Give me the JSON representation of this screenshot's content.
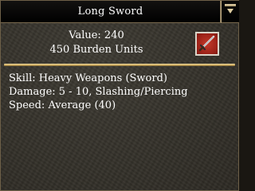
{
  "window": {
    "title": "Long Sword"
  },
  "item": {
    "value_text": "Value: 240",
    "burden_text": "450 Burden Units",
    "icon": "sword-icon"
  },
  "stats": [
    "Skill: Heavy Weapons (Sword)",
    "Damage: 5 - 10, Slashing/Piercing",
    "Speed: Average (40)"
  ],
  "colors": {
    "panel_bg": "#37342d",
    "titlebar_bg": "#000000",
    "gold_divider": "#d9b870",
    "icon_red": "#b12a1e",
    "text": "#ffffff"
  }
}
